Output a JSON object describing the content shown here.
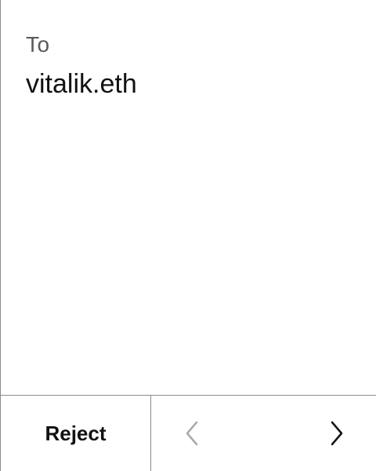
{
  "recipient": {
    "label": "To",
    "value": "vitalik.eth"
  },
  "footer": {
    "reject_label": "Reject",
    "prev_icon": "chevron-left-icon",
    "next_icon": "chevron-right-icon",
    "prev_enabled": false,
    "next_enabled": true
  },
  "colors": {
    "text_primary": "#111111",
    "text_secondary": "#5b5b5b",
    "divider": "#8a8a8a",
    "disabled_icon": "#a9a9a9"
  }
}
